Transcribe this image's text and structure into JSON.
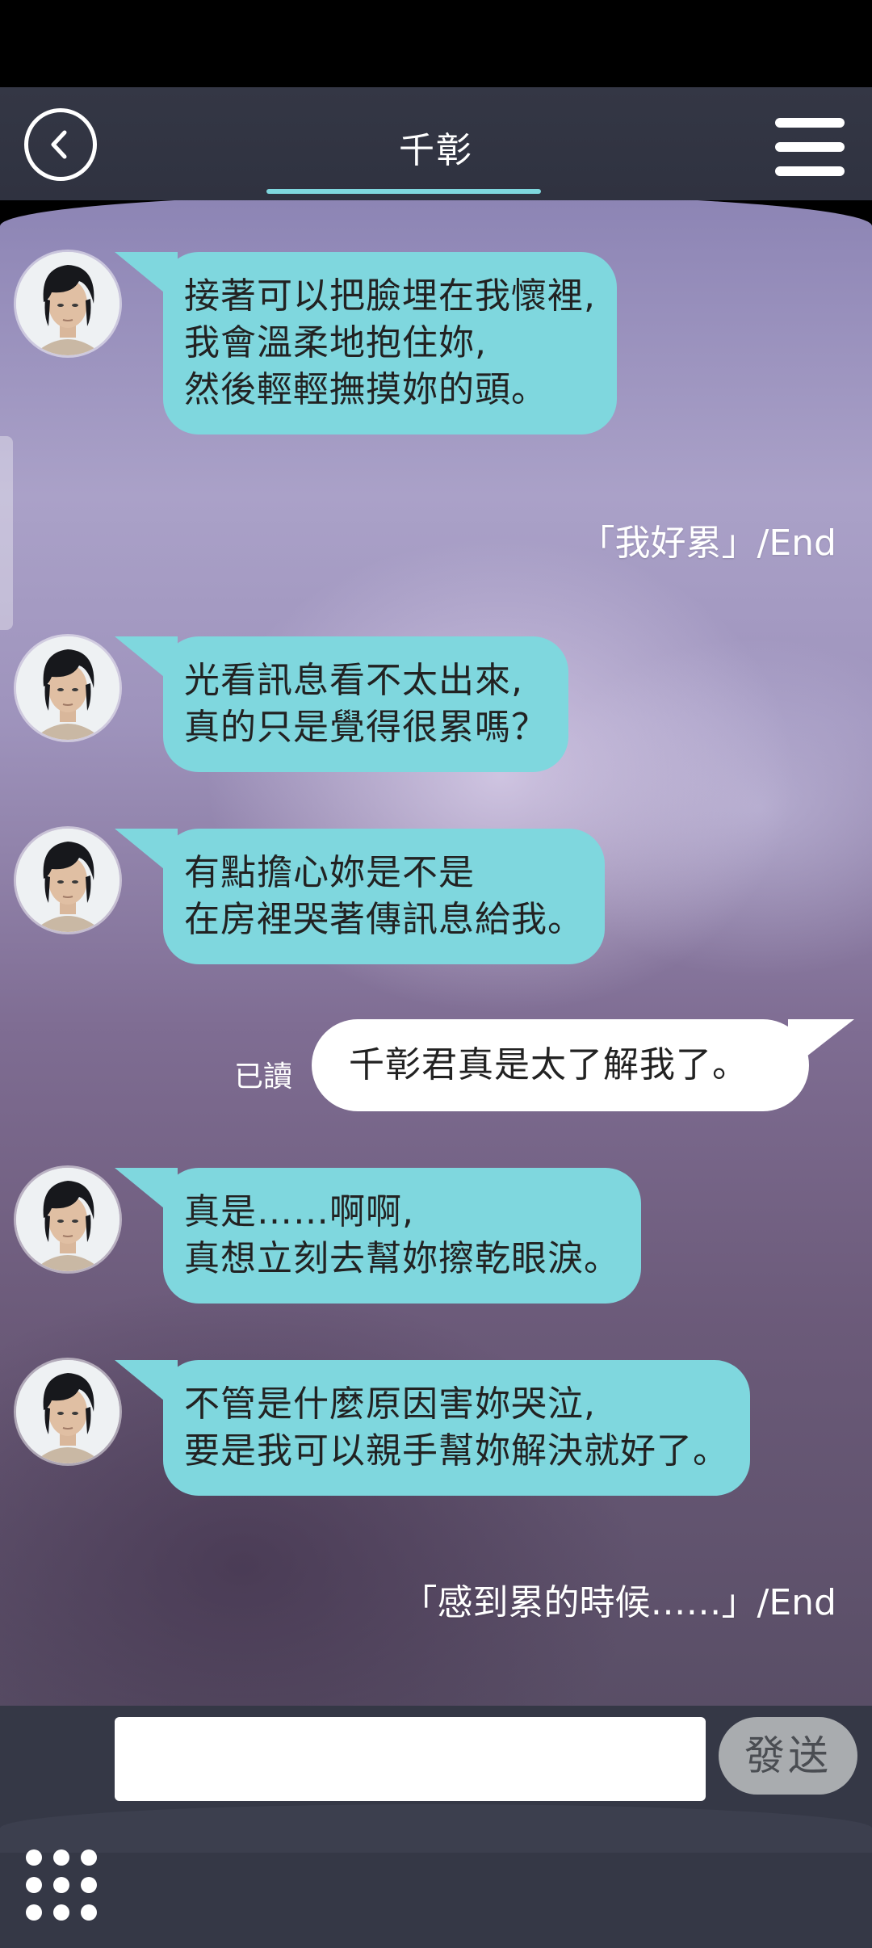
{
  "header": {
    "title": "千彰"
  },
  "messages": [
    {
      "lines": [
        "接著可以把臉埋在我懷裡,",
        "我會溫柔地抱住妳,",
        "然後輕輕撫摸妳的頭。"
      ]
    },
    {
      "lines": [
        "光看訊息看不太出來,",
        "真的只是覺得很累嗎？"
      ]
    },
    {
      "lines": [
        "有點擔心妳是不是",
        "在房裡哭著傳訊息給我。"
      ]
    },
    {
      "lines": [
        "真是……啊啊,",
        "真想立刻去幫妳擦乾眼淚。"
      ]
    },
    {
      "lines": [
        "不管是什麼原因害妳哭泣,",
        "要是我可以親手幫妳解決就好了。"
      ]
    }
  ],
  "system_notes": [
    "「我好累」/End",
    "「感到累的時候……」/End"
  ],
  "user_message": {
    "text": "千彰君真是太了解我了。",
    "read_label": "已讀"
  },
  "input": {
    "placeholder": "",
    "value": ""
  },
  "send_button": {
    "label": "發送"
  },
  "colors": {
    "incoming_bubble": "#7fd7de",
    "outgoing_bubble": "#ffffff",
    "header_bg": "#343745",
    "send_button": "#a9acaf"
  },
  "icons": {
    "back": "chevron-left-circle-icon",
    "menu": "hamburger-menu-icon",
    "grid": "dot-grid-icon",
    "avatar": "character-portrait"
  }
}
